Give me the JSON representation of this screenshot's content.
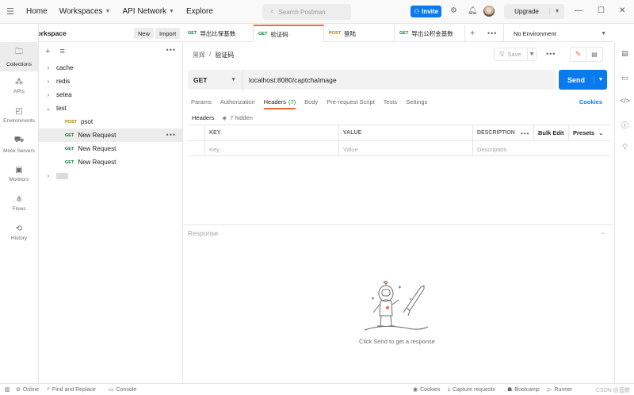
{
  "topbar": {
    "nav": [
      "Home",
      "Workspaces",
      "API Network",
      "Explore"
    ],
    "search_placeholder": "Search Postman",
    "invite_label": "Invite",
    "upgrade_label": "Upgrade"
  },
  "workspace": {
    "name": "My Workspace",
    "new_label": "New",
    "import_label": "Import"
  },
  "leftrail": {
    "items": [
      {
        "label": "Collections",
        "icon": "collections-icon"
      },
      {
        "label": "APIs",
        "icon": "apis-icon"
      },
      {
        "label": "Environments",
        "icon": "environments-icon"
      },
      {
        "label": "Mock Servers",
        "icon": "mock-servers-icon"
      },
      {
        "label": "Monitors",
        "icon": "monitors-icon"
      },
      {
        "label": "Flows",
        "icon": "flows-icon"
      },
      {
        "label": "History",
        "icon": "history-icon"
      }
    ]
  },
  "tree": {
    "folders": [
      "cache",
      "redis",
      "setea",
      "test"
    ],
    "children": [
      {
        "method": "POST",
        "name": "psot"
      },
      {
        "method": "GET",
        "name": "New Request"
      },
      {
        "method": "GET",
        "name": "New Request"
      },
      {
        "method": "GET",
        "name": "New Request"
      }
    ]
  },
  "tabs": [
    {
      "method": "GET",
      "label": "导出比保基数"
    },
    {
      "method": "GET",
      "label": "验证码"
    },
    {
      "method": "POST",
      "label": "登陆"
    },
    {
      "method": "GET",
      "label": "导出公积金基数"
    }
  ],
  "environment": "No Environment",
  "breadcrumb": {
    "parent": "黑辉",
    "current": "验证码"
  },
  "save_label": "Save",
  "request": {
    "method": "GET",
    "url": "localhost:8080/captchaImage",
    "send_label": "Send"
  },
  "reqtabs": [
    "Params",
    "Authorization",
    "Headers",
    "Body",
    "Pre-request Script",
    "Tests",
    "Settings"
  ],
  "headers_count": "(7)",
  "cookies_label": "Cookies",
  "headers_sub": {
    "label": "Headers",
    "hidden": "7 hidden"
  },
  "table": {
    "columns": [
      "KEY",
      "VALUE",
      "DESCRIPTION"
    ],
    "placeholders": [
      "Key",
      "Value",
      "Description"
    ],
    "bulk_edit": "Bulk Edit",
    "presets": "Presets"
  },
  "response": {
    "label": "Response",
    "message": "Click Send to get a response"
  },
  "statusbar": {
    "online": "Online",
    "find": "Find and Replace",
    "console": "Console",
    "cookies": "Cookies",
    "capture": "Capture requests",
    "bootcamp": "Bootcamp",
    "runner": "Runner",
    "watermark": "CSDN @蓝鲸宗"
  },
  "colors": {
    "accent": "#f26b3a",
    "primary": "#097bed",
    "get": "#007f31",
    "post": "#ad7a03"
  }
}
